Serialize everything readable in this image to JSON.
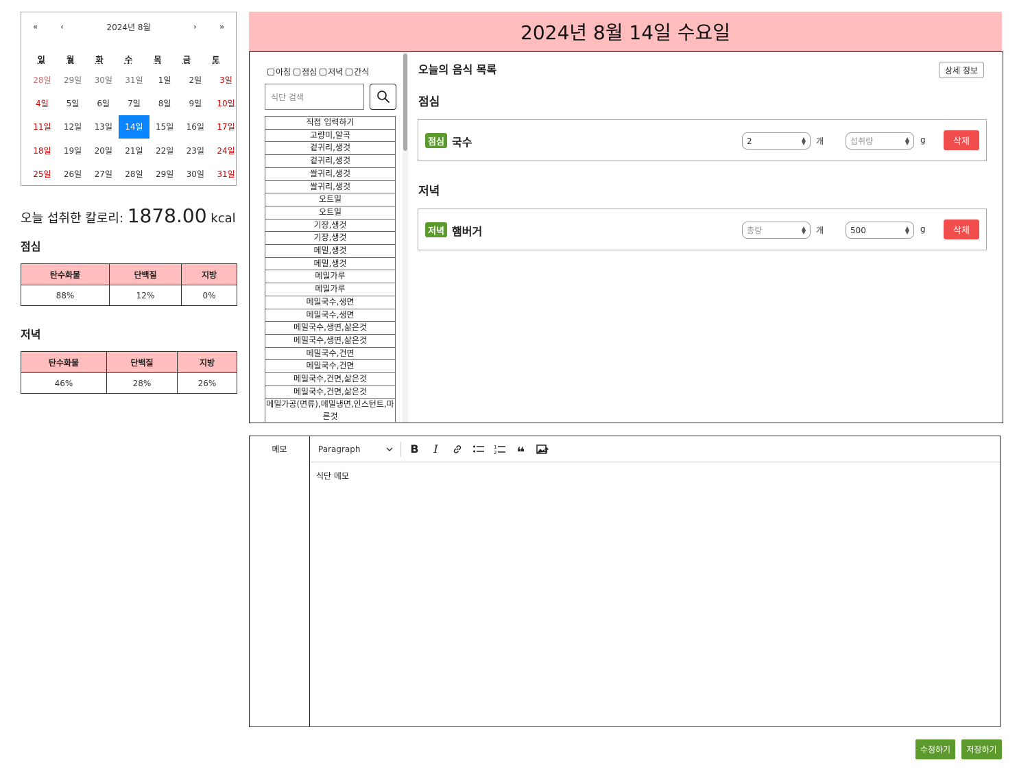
{
  "calendar": {
    "title": "2024년 8월",
    "nav": {
      "prev_year": "«",
      "prev_month": "‹",
      "next_month": "›",
      "next_year": "»"
    },
    "weekdays": [
      "일",
      "월",
      "화",
      "수",
      "목",
      "금",
      "토"
    ],
    "days": [
      "28일",
      "29일",
      "30일",
      "31일",
      "1일",
      "2일",
      "3일",
      "4일",
      "5일",
      "6일",
      "7일",
      "8일",
      "9일",
      "10일",
      "11일",
      "12일",
      "13일",
      "14일",
      "15일",
      "16일",
      "17일",
      "18일",
      "19일",
      "20일",
      "21일",
      "22일",
      "23일",
      "24일",
      "25일",
      "26일",
      "27일",
      "28일",
      "29일",
      "30일",
      "31일"
    ],
    "selected": "14일"
  },
  "summary": {
    "label": "오늘 섭취한 칼로리:",
    "calories": "1878.00",
    "unit": "kcal",
    "meals": [
      {
        "title": "점심",
        "headers": [
          "탄수화물",
          "단백질",
          "지방"
        ],
        "values": [
          "88%",
          "12%",
          "0%"
        ]
      },
      {
        "title": "저녁",
        "headers": [
          "탄수화물",
          "단백질",
          "지방"
        ],
        "values": [
          "46%",
          "28%",
          "26%"
        ]
      }
    ]
  },
  "header": {
    "date": "2024년 8월 14일 수요일"
  },
  "filters": [
    "아침",
    "점심",
    "저녁",
    "간식"
  ],
  "search": {
    "placeholder": "식단 검색"
  },
  "food_list": [
    "직접 입력하기",
    "고량미,알곡",
    "겉귀리,생것",
    "겉귀리,생것",
    "쌀귀리,생것",
    "쌀귀리,생것",
    "오트밀",
    "오트밀",
    "기장,생것",
    "기장,생것",
    "메밀,생것",
    "메밀,생것",
    "메밀가루",
    "메밀가루",
    "메밀국수,생면",
    "메밀국수,생면",
    "메밀국수,생면,삶은것",
    "메밀국수,생면,삶은것",
    "메밀국수,건면",
    "메밀국수,건면",
    "메밀국수,건면,삶은것",
    "메밀국수,건면,삶은것",
    "메밀가공(면류),메밀냉면,인스턴트,마른것"
  ],
  "today": {
    "title": "오늘의 음식 목록",
    "detail_button": "상세 정보",
    "sections": [
      {
        "heading": "점심",
        "badge": "점심",
        "food": "국수",
        "count": "2",
        "count_unit": "개",
        "amount_placeholder": "섭취량",
        "amount_unit": "g",
        "delete": "삭제"
      },
      {
        "heading": "저녁",
        "badge": "저녁",
        "food": "햄버거",
        "count_placeholder": "총량",
        "count_unit": "개",
        "amount": "500",
        "amount_unit": "g",
        "delete": "삭제"
      }
    ]
  },
  "memo": {
    "label": "메모",
    "paragraph": "Paragraph",
    "content": "식단 메모"
  },
  "actions": {
    "edit": "수정하기",
    "save": "저장하기"
  },
  "colors": {
    "header_bg": "#ffbdbd",
    "selected_day": "#0a84ff",
    "badge": "#5d9a2e",
    "delete": "#f24d4d",
    "action": "#5d9a2e"
  }
}
